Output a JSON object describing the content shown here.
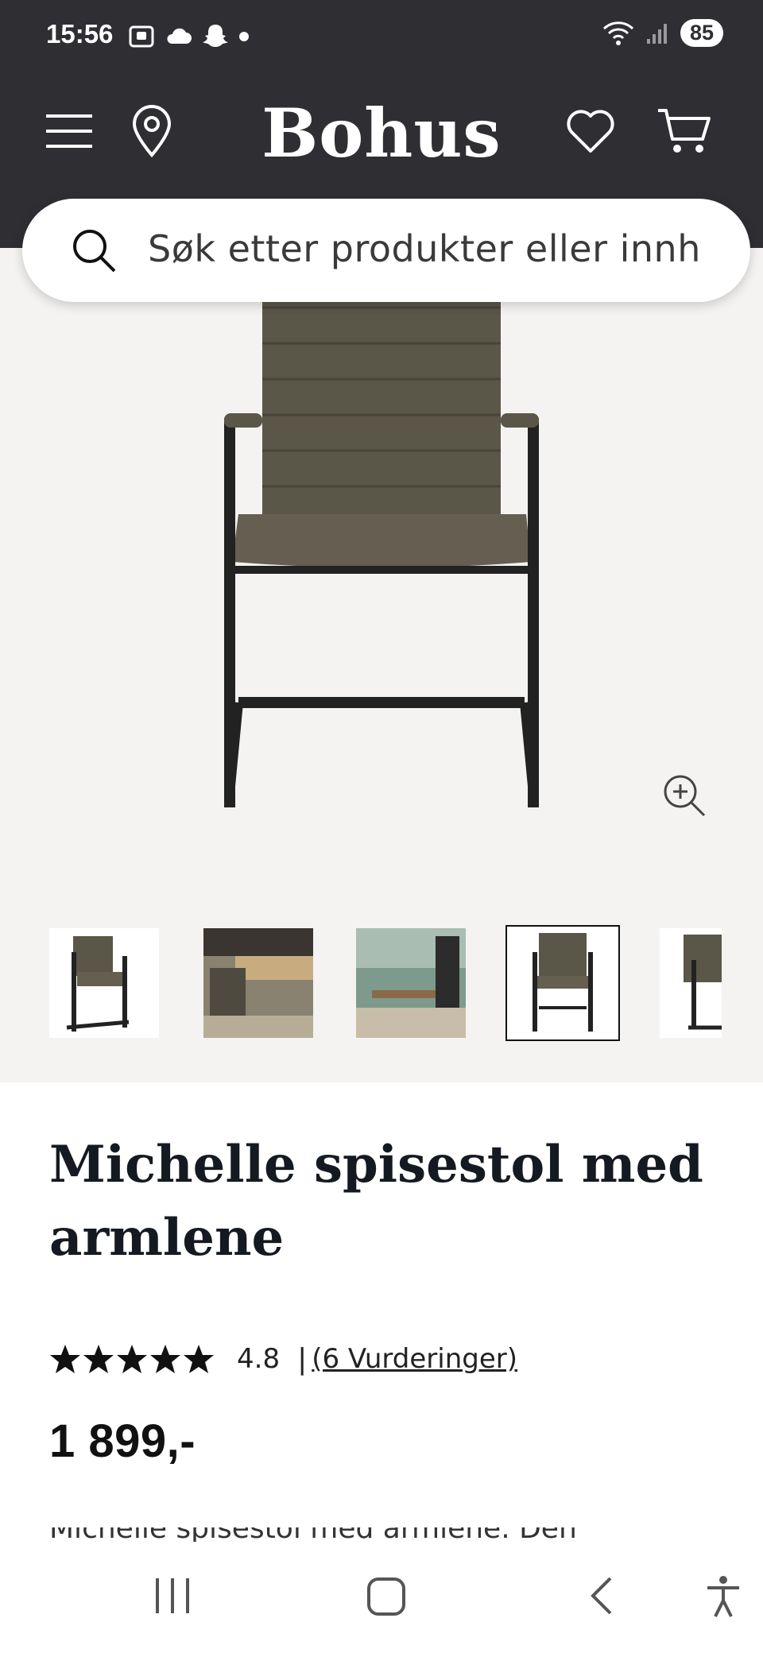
{
  "status_bar": {
    "time": "15:56",
    "battery": "85"
  },
  "header": {
    "logo": "Bohus"
  },
  "search": {
    "placeholder": "Søk etter produkter eller innh"
  },
  "product": {
    "title": "Michelle spisestol med armlene",
    "rating_value": "4.8",
    "rating_separator": "|",
    "rating_count": "(6 Vurderinger)",
    "stars": 5,
    "price": "1 899,-",
    "description_peek": "Michelle spisestol med armlene. Den"
  },
  "gallery": {
    "thumbnail_count": 5,
    "selected_index": 3
  },
  "colors": {
    "header_bg": "#2f2f33",
    "gallery_bg": "#f4f3f1",
    "title_text": "#151a22",
    "chair_upholstery": "#5a5648",
    "chair_frame": "#222222"
  }
}
